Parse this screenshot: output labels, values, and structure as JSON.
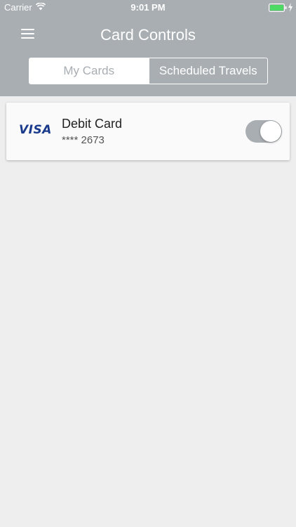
{
  "status_bar": {
    "carrier": "Carrier",
    "time": "9:01 PM",
    "battery_color": "#4cd964"
  },
  "header": {
    "title": "Card Controls",
    "background_color": "#a9aeb2",
    "menu_icon": "hamburger-menu-icon"
  },
  "tabs": [
    {
      "label": "My Cards",
      "selected": true
    },
    {
      "label": "Scheduled Travels",
      "selected": false
    }
  ],
  "cards": [
    {
      "brand": "VISA",
      "name": "Debit Card",
      "number": "**** 2673",
      "enabled": true
    }
  ]
}
